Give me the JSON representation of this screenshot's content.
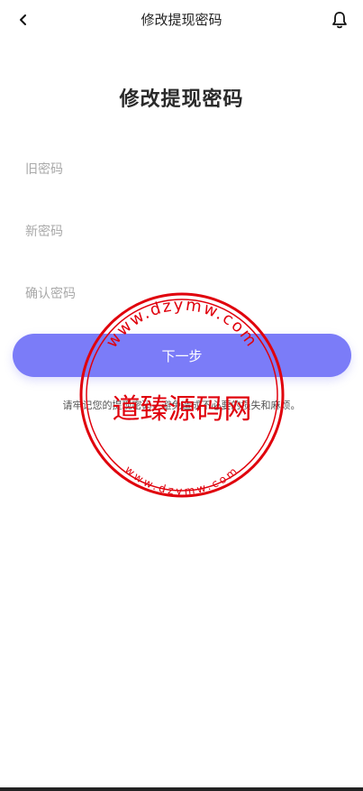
{
  "header": {
    "title": "修改提现密码",
    "back_icon": "chevron-left-icon",
    "bell_icon": "bell-icon"
  },
  "main": {
    "title": "修改提现密码",
    "fields": {
      "old_password": {
        "placeholder": "旧密码",
        "value": ""
      },
      "new_password": {
        "placeholder": "新密码",
        "value": ""
      },
      "confirm_password": {
        "placeholder": "确认密码",
        "value": ""
      }
    },
    "next_label": "下一步",
    "tip": "请牢记您的提现密码，避免造成不必要的损失和麻烦。"
  },
  "watermark": {
    "text": "道臻源码网",
    "ring_text": "www.dzymw.com",
    "color": "#e0000c"
  },
  "colors": {
    "accent": "#7b7cf8"
  }
}
